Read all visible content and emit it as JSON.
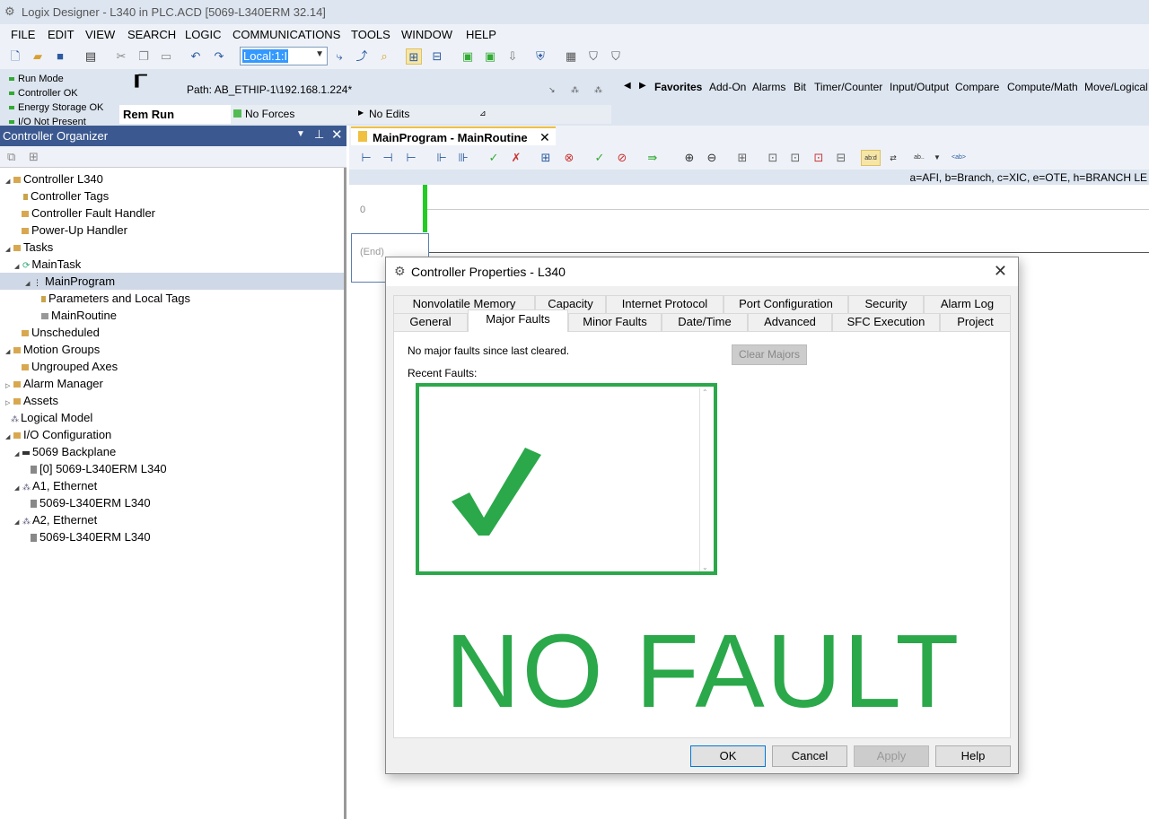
{
  "window": {
    "title": "Logix Designer - L340 in PLC.ACD [5069-L340ERM 32.14]"
  },
  "menu": [
    "FILE",
    "EDIT",
    "VIEW",
    "SEARCH",
    "LOGIC",
    "COMMUNICATIONS",
    "TOOLS",
    "WINDOW",
    "HELP"
  ],
  "toolbar": {
    "path_combo": "Local:1:I"
  },
  "status": {
    "items": [
      "Run Mode",
      "Controller OK",
      "Energy Storage OK",
      "I/O Not Present"
    ],
    "path_label": "Path:  AB_ETHIP-1\\192.168.1.224*",
    "rem_run": "Rem Run",
    "no_forces": "No Forces",
    "no_edits": "No Edits"
  },
  "favorites": [
    "Favorites",
    "Add-On",
    "Alarms",
    "Bit",
    "Timer/Counter",
    "Input/Output",
    "Compare",
    "Compute/Math",
    "Move/Logical"
  ],
  "organizer": {
    "title": "Controller Organizer",
    "tree": [
      "Controller L340",
      "Controller Tags",
      "Controller Fault Handler",
      "Power-Up Handler",
      "Tasks",
      "MainTask",
      "MainProgram",
      "Parameters and Local Tags",
      "MainRoutine",
      "Unscheduled",
      "Motion Groups",
      "Ungrouped Axes",
      "Alarm Manager",
      "Assets",
      "Logical Model",
      "I/O Configuration",
      "5069 Backplane",
      "[0] 5069-L340ERM L340",
      "A1, Ethernet",
      "5069-L340ERM L340",
      "A2, Ethernet",
      "5069-L340ERM L340"
    ]
  },
  "editor": {
    "tab": "MainProgram - MainRoutine",
    "hint": "a=AFI, b=Branch, c=XIC, e=OTE, h=BRANCH LE",
    "rung0": "0",
    "end": "(End)"
  },
  "dialog": {
    "title": "Controller Properties - L340",
    "tabs_row1": [
      "Nonvolatile Memory",
      "Capacity",
      "Internet Protocol",
      "Port Configuration",
      "Security",
      "Alarm Log"
    ],
    "tabs_row2": [
      "General",
      "Major Faults",
      "Minor Faults",
      "Date/Time",
      "Advanced",
      "SFC Execution",
      "Project"
    ],
    "status_text": "No major faults since last cleared.",
    "recent_label": "Recent Faults:",
    "clear_button": "Clear Majors",
    "overlay_text": "NO FAULT",
    "buttons": {
      "ok": "OK",
      "cancel": "Cancel",
      "apply": "Apply",
      "help": "Help"
    }
  },
  "colors": {
    "accent_green": "#2ba84a",
    "header_blue": "#3b5990"
  }
}
